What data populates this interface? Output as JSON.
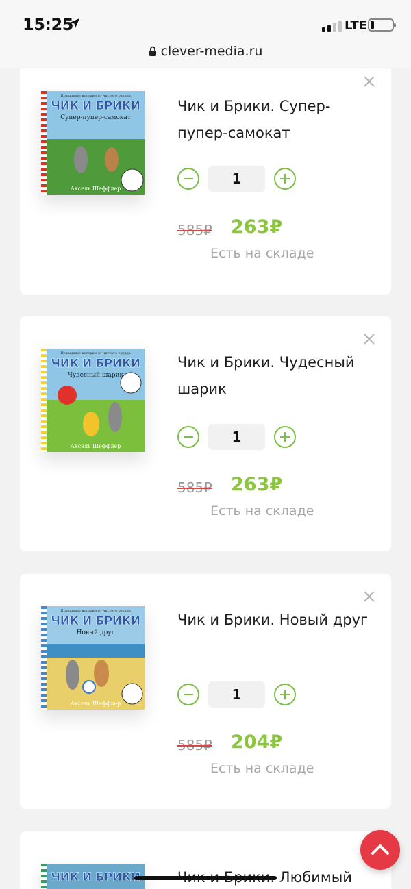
{
  "status": {
    "time": "15:25",
    "network": "LTE",
    "url": "clever-media.ru"
  },
  "cart": {
    "items": [
      {
        "title": "Чик и Брики. Супер-пупер-самокат",
        "cover": {
          "kicker": "Правдивые истории от чистого сердца",
          "brand": "ЧИК И БРИКИ",
          "subtitle": "Супер-пупер-самокат",
          "author": "Аксель Шеффлер",
          "sky": "#8fc6e6",
          "ground": "#4f9a3a",
          "stripe": "#d9342b"
        },
        "quantity": "1",
        "old_price": "585₽",
        "new_price": "263₽",
        "stock": "Есть на складе"
      },
      {
        "title": "Чик и Брики. Чудесный шарик",
        "cover": {
          "kicker": "Правдивые истории от чистого сердца",
          "brand": "ЧИК И БРИКИ",
          "subtitle": "Чудесный шарик",
          "author": "Аксель Шеффлер",
          "sky": "#8fc6e6",
          "ground": "#7cbf3c",
          "stripe": "#f2d23a"
        },
        "quantity": "1",
        "old_price": "585₽",
        "new_price": "263₽",
        "stock": "Есть на складе"
      },
      {
        "title": "Чик и Брики. Новый друг",
        "cover": {
          "kicker": "Правдивые истории от чистого сердца",
          "brand": "ЧИК И БРИКИ",
          "subtitle": "Новый друг",
          "author": "Аксель Шеффлер",
          "sky": "#9ccbe8",
          "ground": "#e8cf6a",
          "stripe": "#4c86c9"
        },
        "quantity": "1",
        "old_price": "585₽",
        "new_price": "204₽",
        "stock": "Есть на складе"
      },
      {
        "title": "Чик и Брики. Любимый",
        "cover": {
          "brand": "ЧИК И БРИКИ",
          "sky": "#6aa9c9",
          "ground": "#6aa9c9",
          "stripe": "#3a9b5a"
        }
      }
    ]
  },
  "colors": {
    "accent": "#8cc63f",
    "fab": "#e63946",
    "strike": "#dd4444"
  }
}
